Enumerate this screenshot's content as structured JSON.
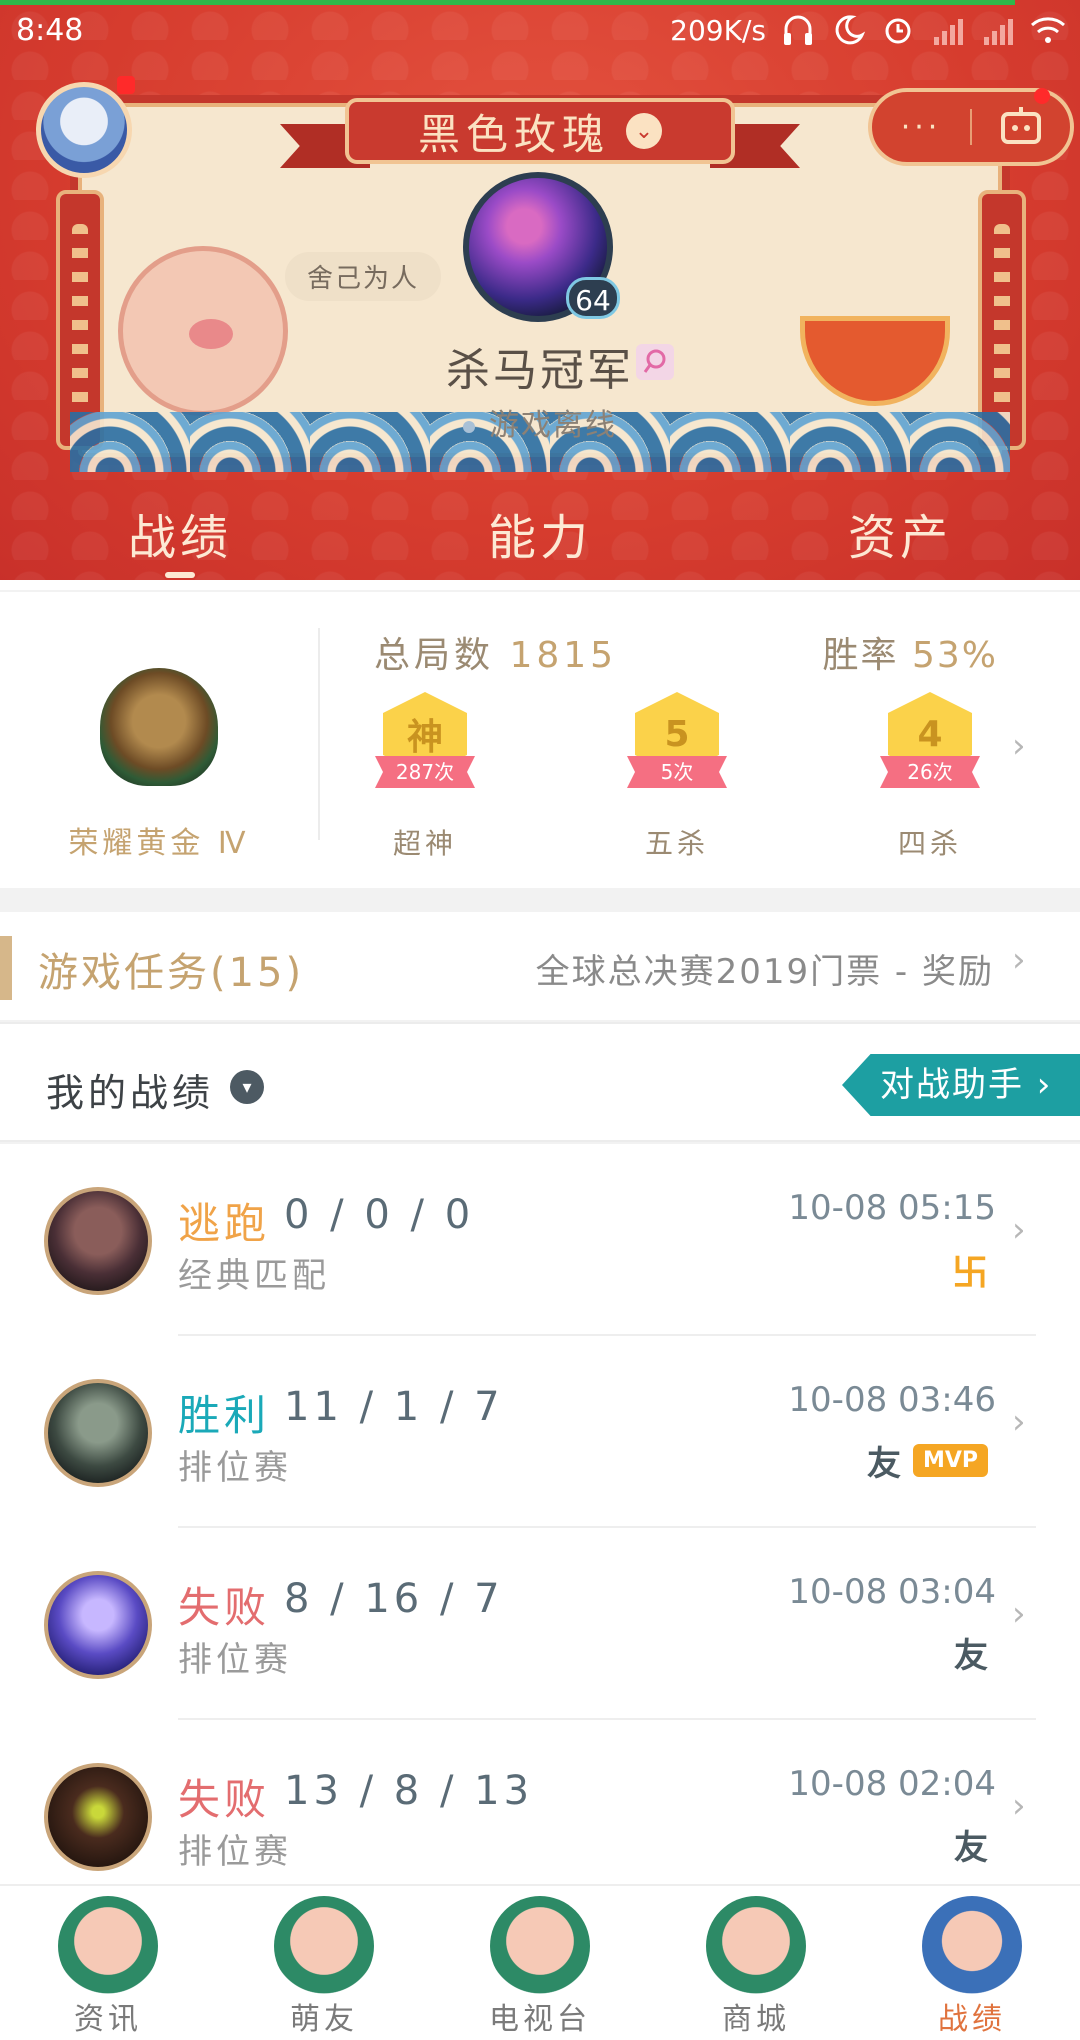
{
  "status_bar": {
    "time": "8:48",
    "net_speed": "209K/s"
  },
  "header": {
    "account_name": "黑色玫瑰",
    "nickname_tag": "舍己为人",
    "level": "64",
    "player_name": "杀马冠军",
    "online_status": "游戏离线",
    "more_label": "···",
    "tabs": [
      {
        "label": "战绩"
      },
      {
        "label": "能力"
      },
      {
        "label": "资产"
      }
    ]
  },
  "stats": {
    "rank": "荣耀黄金 Ⅳ",
    "total_label": "总局数",
    "total_value": "1815",
    "winrate_label": "胜率",
    "winrate_value": "53%",
    "medals": [
      {
        "glyph": "神",
        "count": "287次",
        "label": "超神"
      },
      {
        "glyph": "5",
        "count": "5次",
        "label": "五杀"
      },
      {
        "glyph": "4",
        "count": "26次",
        "label": "四杀"
      }
    ]
  },
  "mission": {
    "title": "游戏任务(15)",
    "reward": "全球总决赛2019门票 - 奖励"
  },
  "my_record": {
    "title": "我的战绩",
    "assistant_button": "对战助手"
  },
  "matches": [
    {
      "result": "逃跑",
      "kda": "0 / 0 / 0",
      "mode": "经典匹配",
      "time": "10-08 05:15",
      "badge_flee": "卐",
      "badge_friend": "",
      "badge_mvp": ""
    },
    {
      "result": "胜利",
      "kda": "11 / 1 / 7",
      "mode": "排位赛",
      "time": "10-08 03:46",
      "badge_flee": "",
      "badge_friend": "友",
      "badge_mvp": "MVP"
    },
    {
      "result": "失败",
      "kda": "8 / 16 / 7",
      "mode": "排位赛",
      "time": "10-08 03:04",
      "badge_flee": "",
      "badge_friend": "友",
      "badge_mvp": ""
    },
    {
      "result": "失败",
      "kda": "13 / 8 / 13",
      "mode": "排位赛",
      "time": "10-08 02:04",
      "badge_flee": "",
      "badge_friend": "友",
      "badge_mvp": ""
    }
  ],
  "bottom_nav": [
    {
      "label": "资讯"
    },
    {
      "label": "萌友"
    },
    {
      "label": "电视台"
    },
    {
      "label": "商城"
    },
    {
      "label": "战绩"
    }
  ],
  "colors": {
    "header_red": "#d63c2e",
    "gold": "#c5a370",
    "win": "#1aa9b8",
    "lose": "#e36d6f",
    "escape": "#f0a348",
    "assistant": "#1d9fa2"
  }
}
